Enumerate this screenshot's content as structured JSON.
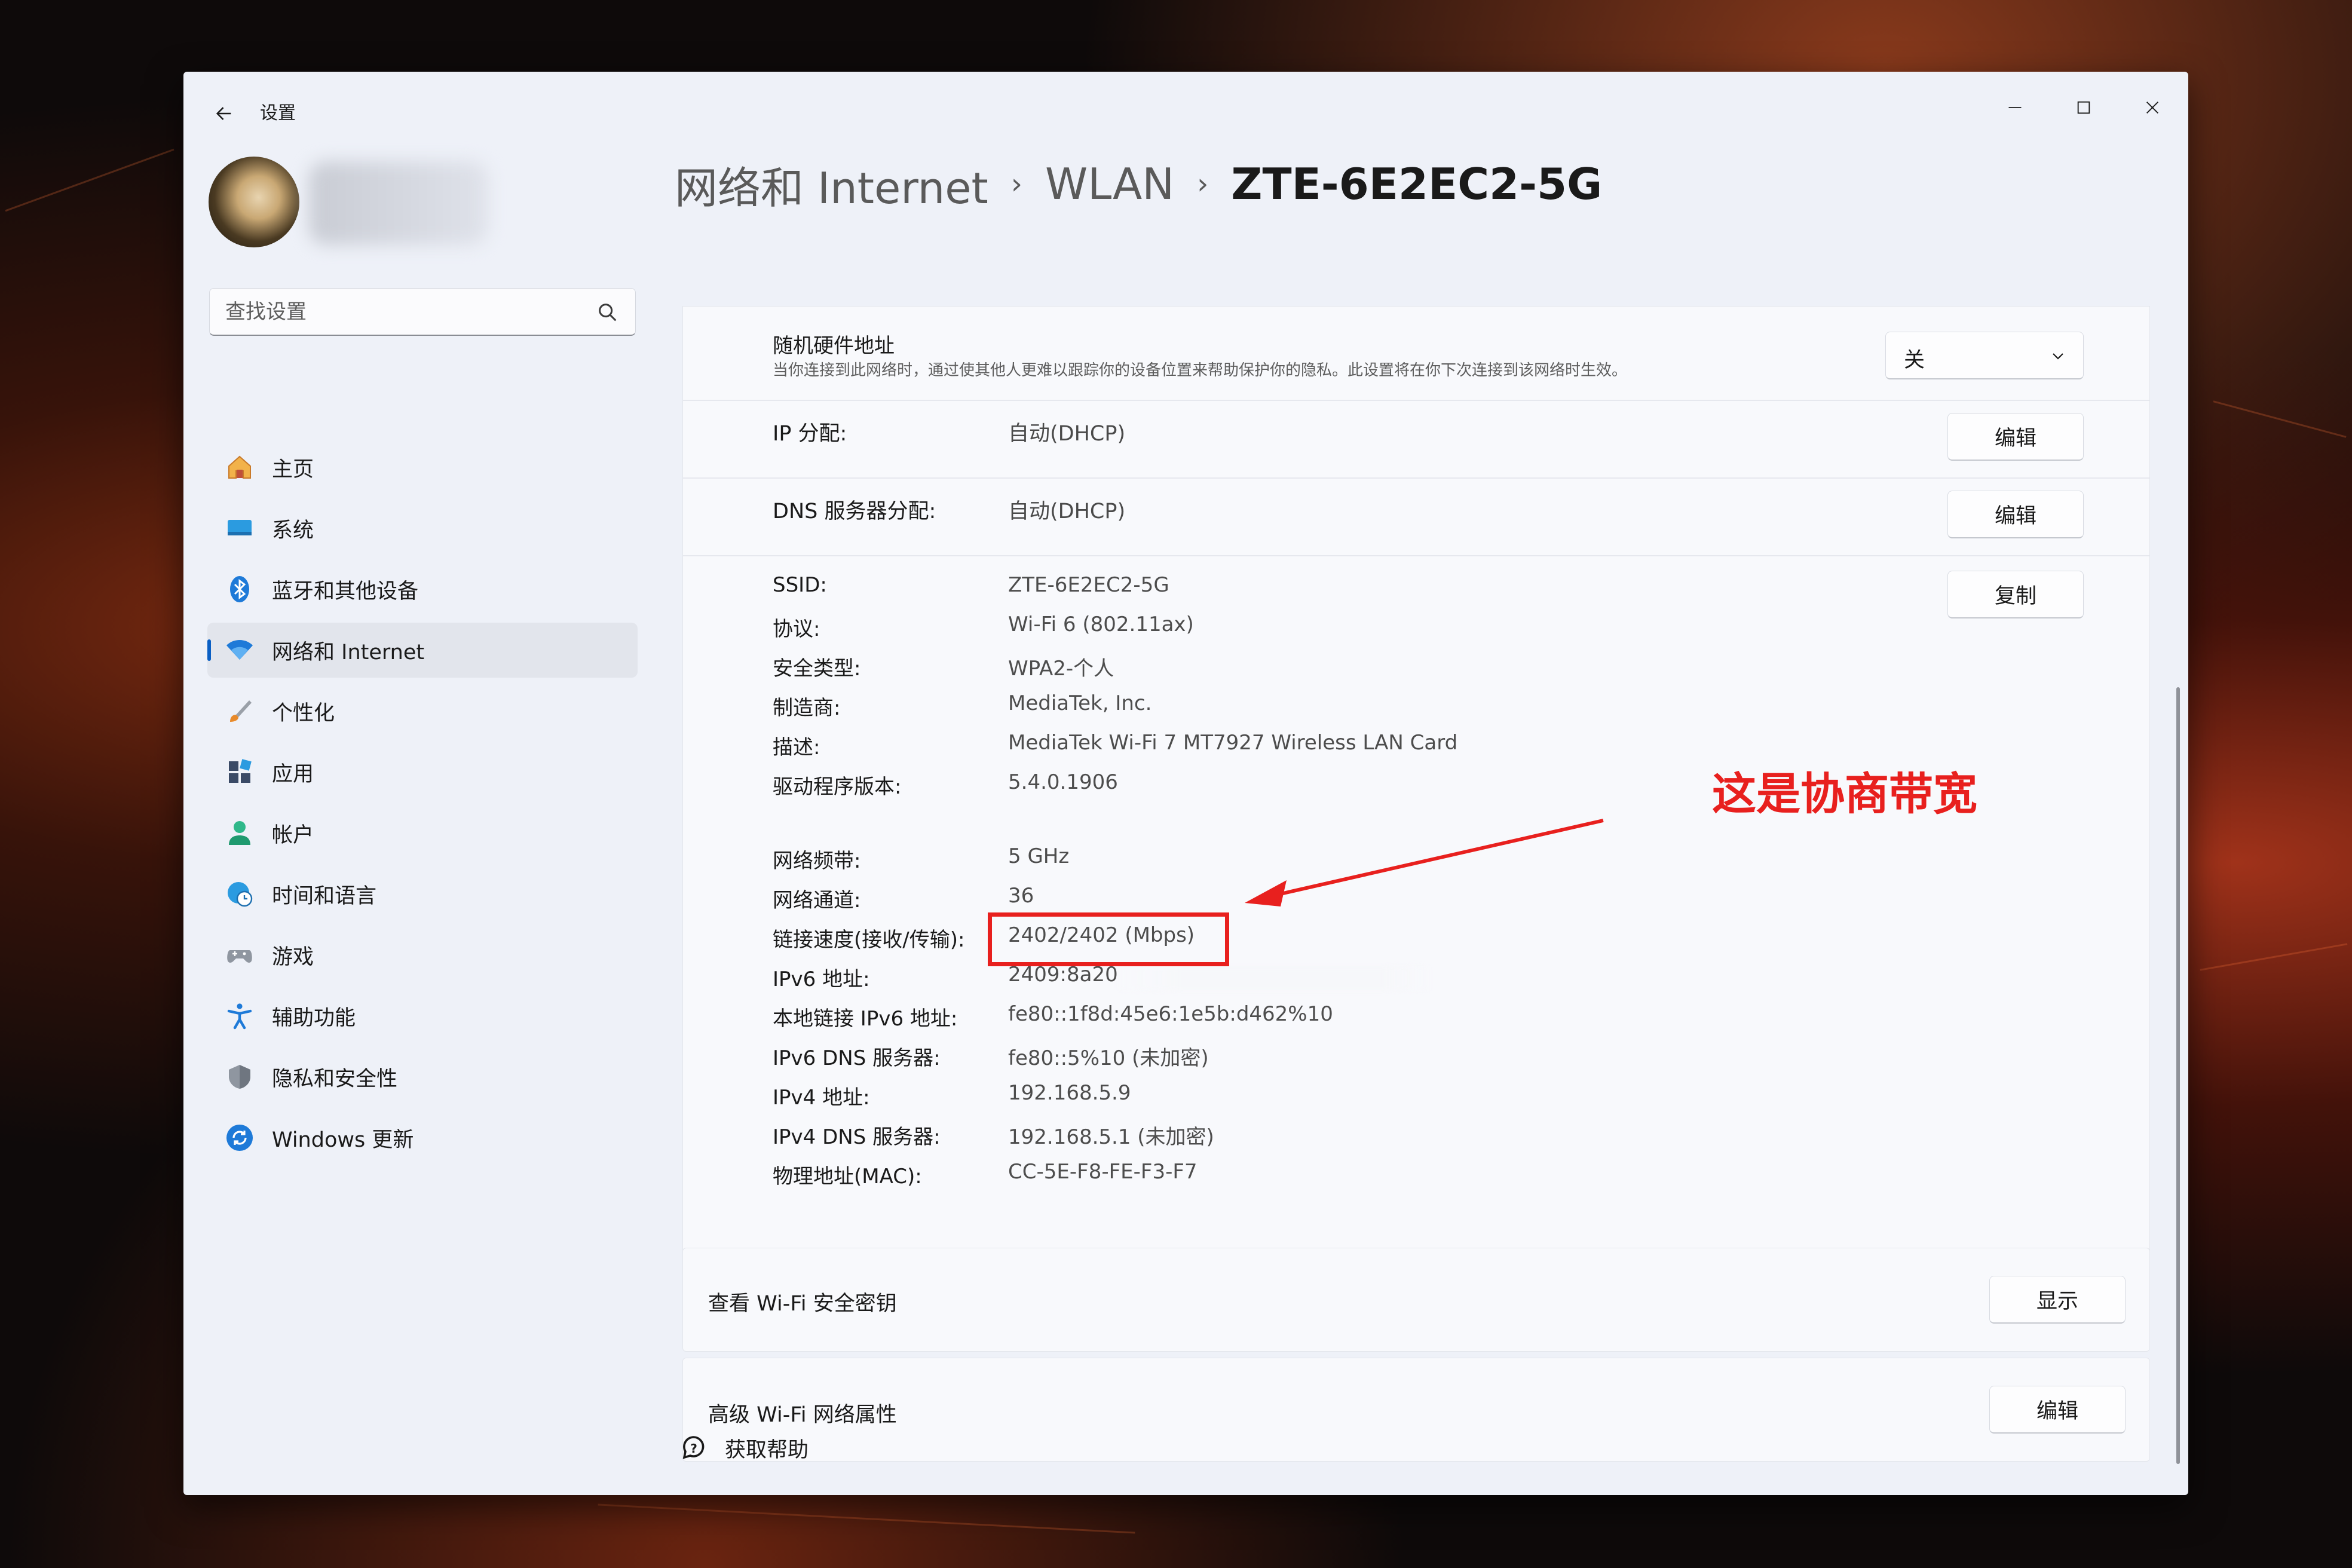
{
  "window": {
    "app_title": "设置",
    "back_icon": "arrow-left-icon",
    "controls": [
      "minimize-icon",
      "maximize-icon",
      "close-icon"
    ]
  },
  "sidebar": {
    "search": {
      "placeholder": "查找设置",
      "icon": "search-icon"
    },
    "items": [
      {
        "label": "主页",
        "icon": "home-icon",
        "selected": false
      },
      {
        "label": "系统",
        "icon": "system-icon",
        "selected": false
      },
      {
        "label": "蓝牙和其他设备",
        "icon": "bluetooth-icon",
        "selected": false
      },
      {
        "label": "网络和 Internet",
        "icon": "wifi-icon",
        "selected": true
      },
      {
        "label": "个性化",
        "icon": "brush-icon",
        "selected": false
      },
      {
        "label": "应用",
        "icon": "apps-icon",
        "selected": false
      },
      {
        "label": "帐户",
        "icon": "account-icon",
        "selected": false
      },
      {
        "label": "时间和语言",
        "icon": "globe-clock-icon",
        "selected": false
      },
      {
        "label": "游戏",
        "icon": "gamepad-icon",
        "selected": false
      },
      {
        "label": "辅助功能",
        "icon": "accessibility-icon",
        "selected": false
      },
      {
        "label": "隐私和安全性",
        "icon": "shield-icon",
        "selected": false
      },
      {
        "label": "Windows 更新",
        "icon": "update-icon",
        "selected": false
      }
    ]
  },
  "header": {
    "breadcrumb": [
      "网络和 Internet",
      "WLAN",
      "ZTE-6E2EC2-5G"
    ]
  },
  "settings": {
    "random_mac": {
      "title": "随机硬件地址",
      "description": "当你连接到此网络时，通过使其他人更难以跟踪你的设备位置来帮助保护你的隐私。此设置将在你下次连接到该网络时生效。",
      "value": "关"
    },
    "ip_assignment": {
      "label": "IP 分配:",
      "value": "自动(DHCP)",
      "button": "编辑"
    },
    "dns_assignment": {
      "label": "DNS 服务器分配:",
      "value": "自动(DHCP)",
      "button": "编辑"
    },
    "copy_button": "复制",
    "properties": [
      {
        "label": "SSID:",
        "value": "ZTE-6E2EC2-5G"
      },
      {
        "label": "协议:",
        "value": "Wi-Fi 6 (802.11ax)"
      },
      {
        "label": "安全类型:",
        "value": "WPA2-个人"
      },
      {
        "label": "制造商:",
        "value": "MediaTek, Inc."
      },
      {
        "label": "描述:",
        "value": "MediaTek Wi-Fi 7 MT7927 Wireless LAN Card"
      },
      {
        "label": "驱动程序版本:",
        "value": "5.4.0.1906"
      },
      {
        "label": "网络频带:",
        "value": "5 GHz"
      },
      {
        "label": "网络通道:",
        "value": "36"
      },
      {
        "label": "链接速度(接收/传输):",
        "value": "2402/2402 (Mbps)"
      },
      {
        "label": "IPv6 地址:",
        "value": "2409:8a20"
      },
      {
        "label": "本地链接 IPv6 地址:",
        "value": "fe80::1f8d:45e6:1e5b:d462%10"
      },
      {
        "label": "IPv6 DNS 服务器:",
        "value": "fe80::5%10 (未加密)"
      },
      {
        "label": "IPv4 地址:",
        "value": "192.168.5.9"
      },
      {
        "label": "IPv4 DNS 服务器:",
        "value": "192.168.5.1 (未加密)"
      },
      {
        "label": "物理地址(MAC):",
        "value": "CC-5E-F8-FE-F3-F7"
      }
    ],
    "security_key": {
      "label": "查看 Wi-Fi 安全密钥",
      "button": "显示"
    },
    "advanced": {
      "label": "高级 Wi-Fi 网络属性",
      "button": "编辑"
    }
  },
  "annotation": {
    "text": "这是协商带宽",
    "color": "#e8201e"
  },
  "footer": {
    "help_label": "获取帮助",
    "help_icon": "help-chat-icon"
  },
  "colors": {
    "accent": "#0a5fc4",
    "annotation_red": "#e8201e"
  }
}
